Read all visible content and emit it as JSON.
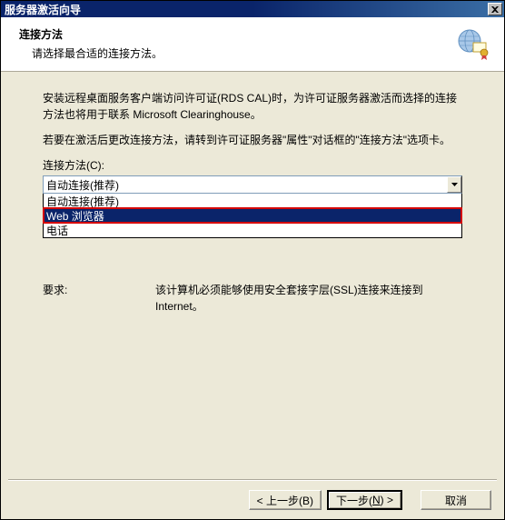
{
  "window": {
    "title": "服务器激活向导"
  },
  "header": {
    "title": "连接方法",
    "subtitle": "请选择最合适的连接方法。"
  },
  "info": {
    "p1": "安装远程桌面服务客户端访问许可证(RDS CAL)时，为许可证服务器激活而选择的连接方法也将用于联系 Microsoft Clearinghouse。",
    "p2": "若要在激活后更改连接方法，请转到许可证服务器\"属性\"对话框的\"连接方法\"选项卡。"
  },
  "combo": {
    "label": "连接方法(C):",
    "selected": "自动连接(推荐)",
    "options": {
      "opt1": "自动连接(推荐)",
      "opt2": "Web 浏览器",
      "opt3": "电话"
    }
  },
  "requirements": {
    "label": "要求:",
    "text": "该计算机必须能够使用安全套接字层(SSL)连接来连接到 Internet。"
  },
  "buttons": {
    "back": "< 上一步(B)",
    "next_prefix": "下一步(",
    "next_key": "N",
    "next_suffix": ") >",
    "cancel": "取消"
  }
}
